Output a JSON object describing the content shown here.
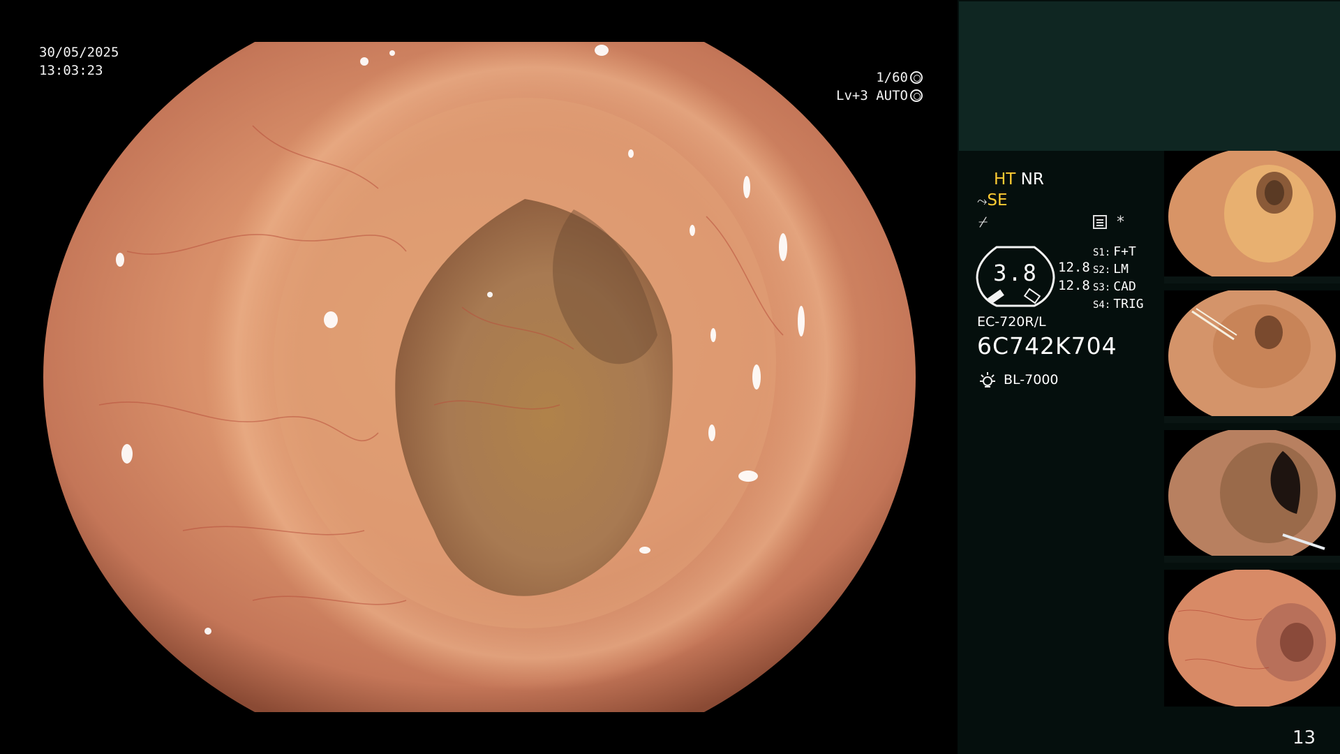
{
  "overlay": {
    "date": "30/05/2025",
    "time": "13:03:23",
    "shutter": "1/60",
    "level": "Lv+3",
    "mode": "AUTO"
  },
  "panel": {
    "ht": "HT",
    "nr": "NR",
    "se": "SE",
    "filter_symbol": "⌿",
    "star": "*",
    "gauge_value": "3.8",
    "value_1": "12.8",
    "value_2": "12.8",
    "settings": [
      {
        "key": "S1:",
        "value": "F+T"
      },
      {
        "key": "S2:",
        "value": "LM"
      },
      {
        "key": "S3:",
        "value": "CAD"
      },
      {
        "key": "S4:",
        "value": "TRIG"
      }
    ],
    "scope_model": "EC-720R/L",
    "serial": "6C742K704",
    "light_source": "BL-7000",
    "image_count": "13"
  },
  "colors": {
    "accent_yellow": "#ffcc33",
    "panel_bg": "#050f0d",
    "panel_top": "#0f2622"
  }
}
